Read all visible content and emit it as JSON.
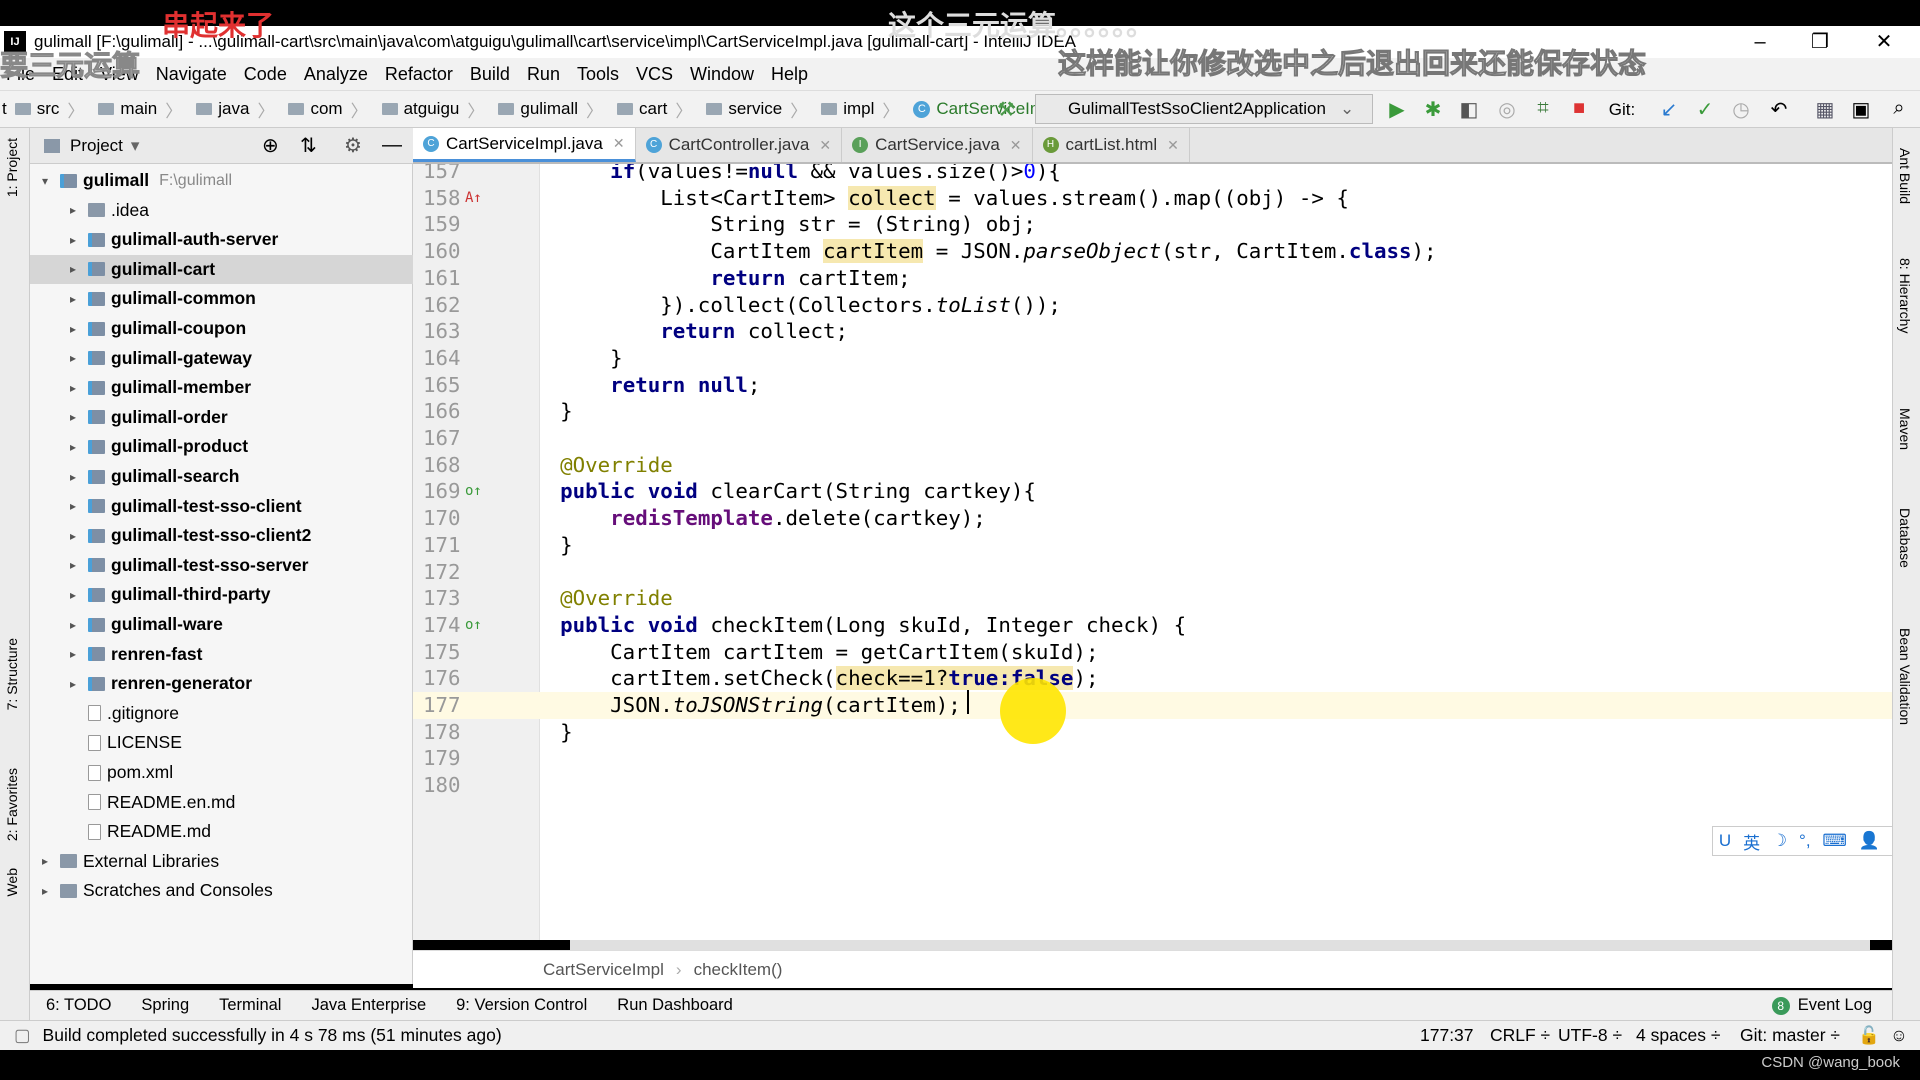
{
  "window": {
    "title": "gulimall [F:\\gulimall] - ...\\gulimall-cart\\src\\main\\java\\com\\atguigu\\gulimall\\cart\\service\\impl\\CartServiceImpl.java [gulimall-cart] - IntelliJ IDEA",
    "logo": "IJ",
    "minimize": "–",
    "restore": "❐",
    "close": "✕"
  },
  "subtitles": {
    "red": "串起来了",
    "top": "这个三元运算。。。。。。",
    "main": "这样能让你修改选中之后退出回来还能保存状态",
    "left": "要三元运算"
  },
  "menu": [
    "File",
    "Edit",
    "View",
    "Navigate",
    "Code",
    "Analyze",
    "Refactor",
    "Build",
    "Run",
    "Tools",
    "VCS",
    "Window",
    "Help"
  ],
  "nav": {
    "crumbs": [
      "src",
      "main",
      "java",
      "com",
      "atguigu",
      "gulimall",
      "cart",
      "service",
      "impl"
    ],
    "class": "CartServiceImpl",
    "leading": "t",
    "run_config": "GulimallTestSsoClient2Application",
    "git_label": "Git:"
  },
  "project": {
    "title": "Project",
    "tree": [
      {
        "label": "gulimall",
        "extra": "F:\\gulimall",
        "bold": true,
        "arrow": "▾",
        "depth": 0,
        "type": "mod"
      },
      {
        "label": ".idea",
        "arrow": "▸",
        "depth": 1,
        "type": "dir"
      },
      {
        "label": "gulimall-auth-server",
        "bold": true,
        "arrow": "▸",
        "depth": 1,
        "type": "mod"
      },
      {
        "label": "gulimall-cart",
        "bold": true,
        "arrow": "▸",
        "depth": 1,
        "type": "mod",
        "selected": true
      },
      {
        "label": "gulimall-common",
        "bold": true,
        "arrow": "▸",
        "depth": 1,
        "type": "mod"
      },
      {
        "label": "gulimall-coupon",
        "bold": true,
        "arrow": "▸",
        "depth": 1,
        "type": "mod"
      },
      {
        "label": "gulimall-gateway",
        "bold": true,
        "arrow": "▸",
        "depth": 1,
        "type": "mod"
      },
      {
        "label": "gulimall-member",
        "bold": true,
        "arrow": "▸",
        "depth": 1,
        "type": "mod"
      },
      {
        "label": "gulimall-order",
        "bold": true,
        "arrow": "▸",
        "depth": 1,
        "type": "mod"
      },
      {
        "label": "gulimall-product",
        "bold": true,
        "arrow": "▸",
        "depth": 1,
        "type": "mod"
      },
      {
        "label": "gulimall-search",
        "bold": true,
        "arrow": "▸",
        "depth": 1,
        "type": "mod"
      },
      {
        "label": "gulimall-test-sso-client",
        "bold": true,
        "arrow": "▸",
        "depth": 1,
        "type": "mod"
      },
      {
        "label": "gulimall-test-sso-client2",
        "bold": true,
        "arrow": "▸",
        "depth": 1,
        "type": "mod"
      },
      {
        "label": "gulimall-test-sso-server",
        "bold": true,
        "arrow": "▸",
        "depth": 1,
        "type": "mod"
      },
      {
        "label": "gulimall-third-party",
        "bold": true,
        "arrow": "▸",
        "depth": 1,
        "type": "mod"
      },
      {
        "label": "gulimall-ware",
        "bold": true,
        "arrow": "▸",
        "depth": 1,
        "type": "mod"
      },
      {
        "label": "renren-fast",
        "bold": true,
        "arrow": "▸",
        "depth": 1,
        "type": "mod"
      },
      {
        "label": "renren-generator",
        "bold": true,
        "arrow": "▸",
        "depth": 1,
        "type": "mod"
      },
      {
        "label": ".gitignore",
        "arrow": "",
        "depth": 1,
        "type": "file"
      },
      {
        "label": "LICENSE",
        "arrow": "",
        "depth": 1,
        "type": "file"
      },
      {
        "label": "pom.xml",
        "arrow": "",
        "depth": 1,
        "type": "file"
      },
      {
        "label": "README.en.md",
        "arrow": "",
        "depth": 1,
        "type": "file"
      },
      {
        "label": "README.md",
        "arrow": "",
        "depth": 1,
        "type": "file"
      },
      {
        "label": "External Libraries",
        "arrow": "▸",
        "depth": 0,
        "type": "lib"
      },
      {
        "label": "Scratches and Consoles",
        "arrow": "▸",
        "depth": 0,
        "type": "lib"
      }
    ]
  },
  "left_strip": [
    "1: Project",
    "7: Structure",
    "2: Favorites",
    "Web"
  ],
  "right_strip": [
    "Ant Build",
    "8: Hierarchy",
    "Maven",
    "Database",
    "Bean Validation"
  ],
  "tabs": [
    {
      "label": "CartServiceImpl.java",
      "icon": "C",
      "color": "#4ea3d8",
      "active": true
    },
    {
      "label": "CartController.java",
      "icon": "C",
      "color": "#4ea3d8"
    },
    {
      "label": "CartService.java",
      "icon": "I",
      "color": "#5aa05a"
    },
    {
      "label": "cartList.html",
      "icon": "H",
      "color": "#6a9a3a"
    }
  ],
  "code": [
    {
      "n": "157",
      "t": [
        [
          "        "
        ],
        [
          "if",
          "kw"
        ],
        [
          "(values!="
        ],
        [
          "null",
          "kw"
        ],
        [
          " && values.size()>"
        ],
        [
          "0",
          "num"
        ],
        [
          "){"
        ]
      ]
    },
    {
      "n": "158",
      "m": "A↑",
      "t": [
        [
          "            List<CartItem> "
        ],
        [
          "collect",
          "hl"
        ],
        [
          " = values.stream().map((obj) -> {"
        ]
      ]
    },
    {
      "n": "159",
      "t": [
        [
          "                String str = (String) obj;"
        ]
      ]
    },
    {
      "n": "160",
      "t": [
        [
          "                CartItem "
        ],
        [
          "cartItem",
          "hl"
        ],
        [
          " = JSON."
        ],
        [
          "parseObject",
          "it"
        ],
        [
          "(str, CartItem."
        ],
        [
          "class",
          "kw"
        ],
        [
          ");"
        ]
      ]
    },
    {
      "n": "161",
      "t": [
        [
          "                "
        ],
        [
          "return",
          "kw"
        ],
        [
          " cartItem;"
        ]
      ]
    },
    {
      "n": "162",
      "t": [
        [
          "            }).collect(Collectors."
        ],
        [
          "toList",
          "it"
        ],
        [
          "());"
        ]
      ]
    },
    {
      "n": "163",
      "t": [
        [
          "            "
        ],
        [
          "return",
          "kw"
        ],
        [
          " collect;"
        ]
      ]
    },
    {
      "n": "164",
      "t": [
        [
          "        }"
        ]
      ]
    },
    {
      "n": "165",
      "t": [
        [
          "        "
        ],
        [
          "return null",
          "kw"
        ],
        [
          ";"
        ]
      ]
    },
    {
      "n": "166",
      "t": [
        [
          "    }"
        ]
      ]
    },
    {
      "n": "167",
      "t": []
    },
    {
      "n": "168",
      "t": [
        [
          "    "
        ],
        [
          "@Override",
          "an"
        ]
      ]
    },
    {
      "n": "169",
      "m": "o↑",
      "t": [
        [
          "    "
        ],
        [
          "public void",
          "kw"
        ],
        [
          " clearCart(String cartkey){"
        ]
      ]
    },
    {
      "n": "170",
      "t": [
        [
          "        "
        ],
        [
          "redisTemplate",
          "fld"
        ],
        [
          ".delete(cartkey);"
        ]
      ]
    },
    {
      "n": "171",
      "t": [
        [
          "    }"
        ]
      ]
    },
    {
      "n": "172",
      "t": []
    },
    {
      "n": "173",
      "t": [
        [
          "    "
        ],
        [
          "@Override",
          "an"
        ]
      ]
    },
    {
      "n": "174",
      "m": "o↑",
      "t": [
        [
          "    "
        ],
        [
          "public void",
          "kw"
        ],
        [
          " checkItem(Long skuId, Integer check) {"
        ]
      ]
    },
    {
      "n": "175",
      "t": [
        [
          "        CartItem cartItem = getCartItem(skuId);"
        ]
      ]
    },
    {
      "n": "176",
      "t": [
        [
          "        cartItem.setCheck("
        ],
        [
          "check==1?",
          "hl"
        ],
        [
          "true:false",
          "hl kw"
        ],
        [
          ");"
        ]
      ]
    },
    {
      "n": "177",
      "cur": true,
      "t": [
        [
          "        JSON."
        ],
        [
          "toJSONString",
          "it"
        ],
        [
          "(cartItem);"
        ]
      ]
    },
    {
      "n": "178",
      "t": [
        [
          "    }"
        ]
      ]
    },
    {
      "n": "179",
      "t": []
    },
    {
      "n": "180",
      "t": []
    }
  ],
  "editor_breadcrumb": [
    "CartServiceImpl",
    "checkItem()"
  ],
  "ime": [
    "U",
    "英",
    "☽",
    "°,",
    "⌨",
    "👤",
    "🔧"
  ],
  "tool_windows": [
    "6: TODO",
    "Spring",
    "Terminal",
    "Java Enterprise",
    "9: Version Control",
    "Run Dashboard"
  ],
  "event_log": "Event Log",
  "event_count": "8",
  "status": {
    "message": "Build completed successfully in 4 s 78 ms (51 minutes ago)",
    "position": "177:37",
    "line_sep": "CRLF ÷",
    "encoding": "UTF-8 ÷",
    "indent": "4 spaces ÷",
    "git": "Git: master ÷"
  },
  "watermark": "CSDN @wang_book"
}
